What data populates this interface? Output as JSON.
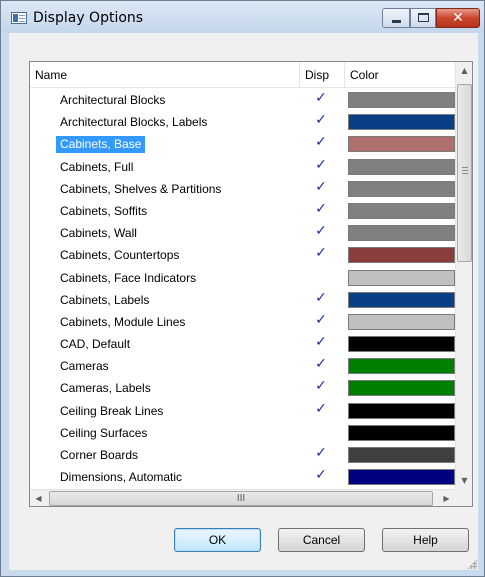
{
  "window": {
    "title": "Display Options",
    "close_glyph": "✕"
  },
  "list": {
    "columns": {
      "name": "Name",
      "disp": "Disp",
      "color": "Color"
    },
    "check_glyph": "✓",
    "rows": [
      {
        "name": "Architectural Blocks",
        "disp": true,
        "color": "#808080"
      },
      {
        "name": "Architectural Blocks, Labels",
        "disp": true,
        "color": "#0b3f85"
      },
      {
        "name": "Cabinets, Base",
        "disp": true,
        "color": "#b07070",
        "selected": true
      },
      {
        "name": "Cabinets, Full",
        "disp": true,
        "color": "#808080"
      },
      {
        "name": "Cabinets, Shelves & Partitions",
        "disp": true,
        "color": "#808080"
      },
      {
        "name": "Cabinets, Soffits",
        "disp": true,
        "color": "#808080"
      },
      {
        "name": "Cabinets, Wall",
        "disp": true,
        "color": "#808080"
      },
      {
        "name": "Cabinets, Countertops",
        "disp": true,
        "color": "#8b3c3c"
      },
      {
        "name": "Cabinets, Face Indicators",
        "disp": false,
        "color": "#c0c0c0"
      },
      {
        "name": "Cabinets, Labels",
        "disp": true,
        "color": "#0b3f85"
      },
      {
        "name": "Cabinets, Module Lines",
        "disp": true,
        "color": "#c0c0c0"
      },
      {
        "name": "CAD, Default",
        "disp": true,
        "color": "#000000"
      },
      {
        "name": "Cameras",
        "disp": true,
        "color": "#008000"
      },
      {
        "name": "Cameras, Labels",
        "disp": true,
        "color": "#008000"
      },
      {
        "name": "Ceiling Break Lines",
        "disp": true,
        "color": "#000000"
      },
      {
        "name": "Ceiling Surfaces",
        "disp": false,
        "color": "#000000"
      },
      {
        "name": "Corner Boards",
        "disp": true,
        "color": "#404040"
      },
      {
        "name": "Dimensions, Automatic",
        "disp": true,
        "color": "#000080"
      }
    ]
  },
  "scrollbar": {
    "up": "▲",
    "down": "▼",
    "left": "◀",
    "right": "▶",
    "thumb_grip": "III"
  },
  "buttons": {
    "ok": "OK",
    "cancel": "Cancel",
    "help": "Help"
  }
}
